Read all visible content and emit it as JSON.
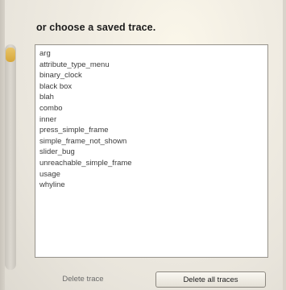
{
  "dialog": {
    "heading": "or choose a saved trace."
  },
  "traces": [
    {
      "label": "arg"
    },
    {
      "label": "attribute_type_menu"
    },
    {
      "label": "binary_clock"
    },
    {
      "label": "black box"
    },
    {
      "label": "blah"
    },
    {
      "label": "combo"
    },
    {
      "label": "inner"
    },
    {
      "label": "press_simple_frame"
    },
    {
      "label": "simple_frame_not_shown"
    },
    {
      "label": "slider_bug"
    },
    {
      "label": "unreachable_simple_frame"
    },
    {
      "label": "usage"
    },
    {
      "label": "whyline"
    }
  ],
  "buttons": {
    "delete_trace": "Delete trace",
    "delete_all_traces": "Delete all traces"
  }
}
